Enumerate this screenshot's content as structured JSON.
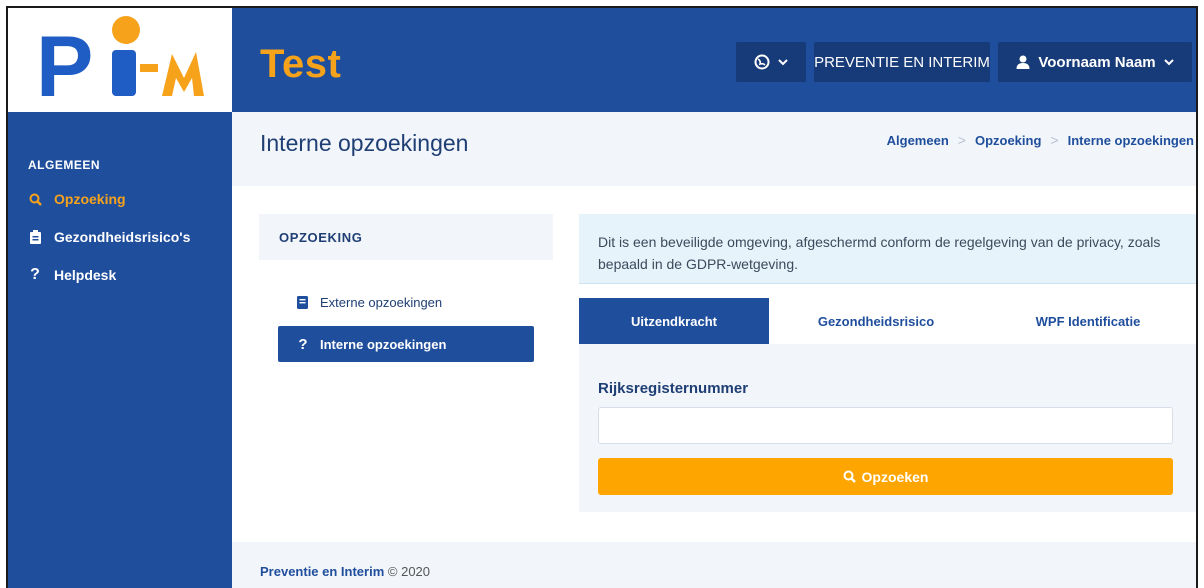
{
  "header": {
    "logo_text": "Pi-M",
    "app_title": "Test",
    "company_button": "PREVENTIE EN INTERIM",
    "user_button": "Voornaam Naam",
    "globe_icon": "globe-icon",
    "user_icon": "user-icon",
    "chevron_icon": "chevron-down-icon"
  },
  "sidebar": {
    "section_title": "ALGEMEEN",
    "items": [
      {
        "label": "Opzoeking",
        "icon": "search-icon",
        "active": true
      },
      {
        "label": "Gezondheidsrisico's",
        "icon": "clipboard-icon",
        "active": false
      },
      {
        "label": "Helpdesk",
        "icon": "question-icon",
        "active": false
      }
    ]
  },
  "page": {
    "title": "Interne opzoekingen",
    "breadcrumb": [
      "Algemeen",
      "Opzoeking",
      "Interne opzoekingen"
    ]
  },
  "left_panel": {
    "title": "OPZOEKING",
    "links": [
      {
        "label": "Externe opzoekingen",
        "icon": "book-icon",
        "active": false
      },
      {
        "label": "Interne opzoekingen",
        "icon": "question-icon",
        "active": true
      }
    ]
  },
  "info": {
    "text": "Dit is een beveiligde omgeving, afgeschermd conform de regelgeving van de privacy, zoals bepaald in de GDPR-wetgeving."
  },
  "tabs": [
    {
      "label": "Uitzendkracht",
      "active": true
    },
    {
      "label": "Gezondheidsrisico",
      "active": false
    },
    {
      "label": "WPF Identificatie",
      "active": false
    }
  ],
  "form": {
    "field_label": "Rijksregisternummer",
    "field_value": "",
    "field_placeholder": "",
    "search_button": "Opzoeken"
  },
  "footer": {
    "link": "Preventie en Interim",
    "copyright": "© 2020"
  },
  "colors": {
    "primary": "#1f4e9c",
    "accent": "#f7a21b",
    "button": "#ffa500",
    "light_bg": "#f2f5fa",
    "info_bg": "#e7f3fa"
  }
}
